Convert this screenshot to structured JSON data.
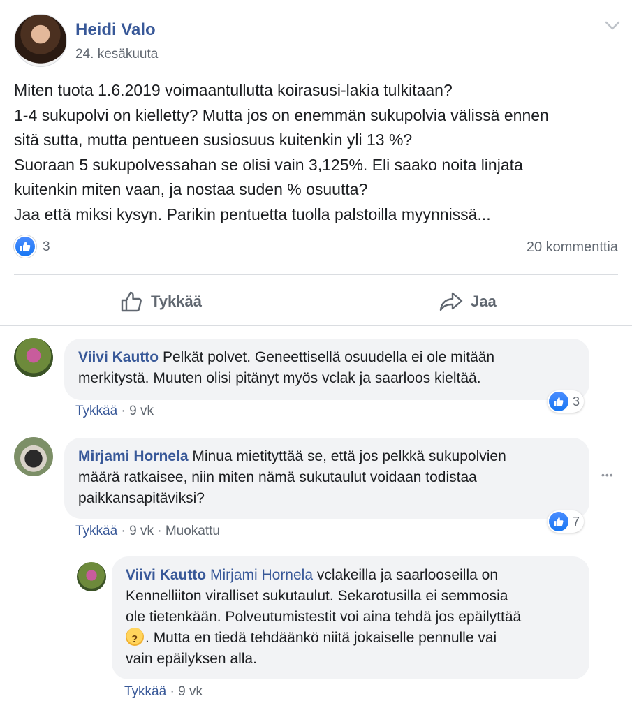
{
  "post": {
    "author": "Heidi Valo",
    "date": "24. kesäkuuta",
    "text_lines": [
      "Miten tuota 1.6.2019 voimaantullutta koirasusi-lakia tulkitaan?",
      "1-4 sukupolvi on kielletty? Mutta jos on enemmän sukupolvia välissä ennen",
      "sitä sutta, mutta pentueen susiosuus kuitenkin yli 13 %?",
      "Suoraan 5 sukupolvessahan se olisi vain 3,125%. Eli saako noita linjata",
      "kuitenkin miten vaan, ja nostaa suden % osuutta?",
      "Jaa että miksi kysyn. Parikin pentuetta tuolla palstoilla myynnissä..."
    ],
    "like_count": "3",
    "comment_count": "20 kommenttia",
    "like_label": "Tykkää",
    "share_label": "Jaa"
  },
  "comments": [
    {
      "author": "Viivi Kautto",
      "lines": [
        "Pelkät polvet. Geneettisellä osuudella ei ole mitään",
        "merkitystä. Muuten olisi pitänyt myös vclak ja saarloos kieltää."
      ],
      "like_link": "Tykkää",
      "time": "9 vk",
      "reactions": "3"
    },
    {
      "author": "Mirjami Hornela",
      "lines": [
        "Minua mietityttää se, että jos pelkkä sukupolvien",
        "määrä ratkaisee, niin miten nämä sukutaulut voidaan todistaa",
        "paikkansapitäviksi?"
      ],
      "like_link": "Tykkää",
      "time": "9 vk",
      "edited": "Muokattu",
      "reactions": "7",
      "more": "•••"
    },
    {
      "author": "Viivi Kautto",
      "mention": "Mirjami Hornela",
      "lines": [
        "vclakeilla ja saarlooseilla on",
        "Kennelliiton viralliset sukutaulut. Sekarotusilla ei semmosia",
        "ole tietenkään. Polveutumistestit voi aina tehdä jos epäilyttää",
        "Mutta en tiedä tehdäänkö niitä jokaiselle pennulle vai",
        "vain epäilyksen alla."
      ],
      "emoji_suffix": ".",
      "like_link": "Tykkää",
      "time": "9 vk"
    }
  ],
  "colors": {
    "name_blue": "#385898",
    "meta_gray": "#606770",
    "bubble_bg": "#f2f3f5",
    "like_blue": "#1877f2"
  },
  "icons": [
    "chevron-down-icon",
    "like-icon",
    "thumbs-up-outline-icon",
    "share-arrow-icon",
    "thinking-face-icon",
    "more-options-icon"
  ]
}
